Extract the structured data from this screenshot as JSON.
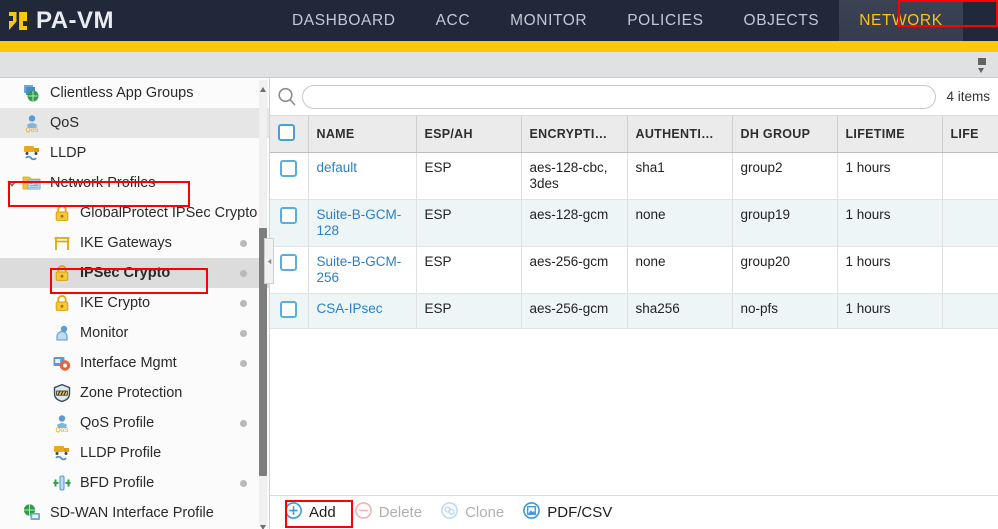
{
  "header": {
    "brand": "PA-VM",
    "logo_icon": "palo-alto-logo-icon",
    "accent_color": "#ffc709",
    "bar_color": "#20283a",
    "active_color": "#ffc20e",
    "nav": [
      {
        "label": "DASHBOARD",
        "active": false
      },
      {
        "label": "ACC",
        "active": false
      },
      {
        "label": "MONITOR",
        "active": false
      },
      {
        "label": "POLICIES",
        "active": false
      },
      {
        "label": "OBJECTS",
        "active": false
      },
      {
        "label": "NETWORK",
        "active": true
      }
    ]
  },
  "sidebar": {
    "items": [
      {
        "label": "Clientless App Groups",
        "icon": "clientless-app-groups-icon",
        "level": 1,
        "selected": false,
        "shaded": false,
        "dot": false,
        "chevron": ""
      },
      {
        "label": "QoS",
        "icon": "qos-icon",
        "level": 1,
        "selected": false,
        "shaded": true,
        "dot": false,
        "chevron": ""
      },
      {
        "label": "LLDP",
        "icon": "lldp-icon",
        "level": 1,
        "selected": false,
        "shaded": false,
        "dot": false,
        "chevron": ""
      },
      {
        "label": "Network Profiles",
        "icon": "folder-network-profiles-icon",
        "level": 1,
        "selected": false,
        "shaded": false,
        "dot": false,
        "chevron": "chevron-down-icon"
      },
      {
        "label": "GlobalProtect IPSec Crypto",
        "icon": "lock-icon",
        "level": 2,
        "selected": false,
        "shaded": false,
        "dot": false,
        "chevron": ""
      },
      {
        "label": "IKE Gateways",
        "icon": "ike-gateway-icon",
        "level": 2,
        "selected": false,
        "shaded": false,
        "dot": true,
        "chevron": ""
      },
      {
        "label": "IPSec Crypto",
        "icon": "lock-icon",
        "level": 2,
        "selected": true,
        "shaded": false,
        "dot": true,
        "chevron": ""
      },
      {
        "label": "IKE Crypto",
        "icon": "lock-icon",
        "level": 2,
        "selected": false,
        "shaded": false,
        "dot": true,
        "chevron": ""
      },
      {
        "label": "Monitor",
        "icon": "monitor-profile-icon",
        "level": 2,
        "selected": false,
        "shaded": false,
        "dot": true,
        "chevron": ""
      },
      {
        "label": "Interface Mgmt",
        "icon": "interface-mgmt-icon",
        "level": 2,
        "selected": false,
        "shaded": false,
        "dot": true,
        "chevron": ""
      },
      {
        "label": "Zone Protection",
        "icon": "zone-protection-icon",
        "level": 2,
        "selected": false,
        "shaded": false,
        "dot": false,
        "chevron": ""
      },
      {
        "label": "QoS Profile",
        "icon": "qos-icon",
        "level": 2,
        "selected": false,
        "shaded": false,
        "dot": true,
        "chevron": ""
      },
      {
        "label": "LLDP Profile",
        "icon": "lldp-icon",
        "level": 2,
        "selected": false,
        "shaded": false,
        "dot": false,
        "chevron": ""
      },
      {
        "label": "BFD Profile",
        "icon": "bfd-profile-icon",
        "level": 2,
        "selected": false,
        "shaded": false,
        "dot": true,
        "chevron": ""
      },
      {
        "label": "SD-WAN Interface Profile",
        "icon": "sdwan-interface-icon",
        "level": 1,
        "selected": false,
        "shaded": false,
        "dot": false,
        "chevron": ""
      }
    ]
  },
  "search": {
    "value": "",
    "placeholder": "",
    "icon": "search-icon",
    "items_count": "4 items"
  },
  "table": {
    "columns": [
      "NAME",
      "ESP/AH",
      "ENCRYPTI…",
      "AUTHENTI…",
      "DH GROUP",
      "LIFETIME",
      "LIFE"
    ],
    "rows": [
      {
        "name": "default",
        "espah": "ESP",
        "encryption": "aes-128-cbc, 3des",
        "authentication": "sha1",
        "dh_group": "group2",
        "lifetime": "1 hours",
        "lifesize": ""
      },
      {
        "name": "Suite-B-GCM-128",
        "espah": "ESP",
        "encryption": "aes-128-gcm",
        "authentication": "none",
        "dh_group": "group19",
        "lifetime": "1 hours",
        "lifesize": ""
      },
      {
        "name": "Suite-B-GCM-256",
        "espah": "ESP",
        "encryption": "aes-256-gcm",
        "authentication": "none",
        "dh_group": "group20",
        "lifetime": "1 hours",
        "lifesize": ""
      },
      {
        "name": "CSA-IPsec",
        "espah": "ESP",
        "encryption": "aes-256-gcm",
        "authentication": "sha256",
        "dh_group": "no-pfs",
        "lifetime": "1 hours",
        "lifesize": ""
      }
    ]
  },
  "footer": {
    "buttons": [
      {
        "label": "Add",
        "icon": "plus-circle-icon",
        "enabled": true
      },
      {
        "label": "Delete",
        "icon": "minus-circle-icon",
        "enabled": false
      },
      {
        "label": "Clone",
        "icon": "clone-icon",
        "enabled": false
      },
      {
        "label": "PDF/CSV",
        "icon": "pdf-csv-icon",
        "enabled": true
      }
    ]
  },
  "annotations": {
    "color": "#ff0000",
    "boxes": [
      "network-tab",
      "network-profiles-item",
      "ipsec-crypto-item",
      "add-button"
    ]
  }
}
